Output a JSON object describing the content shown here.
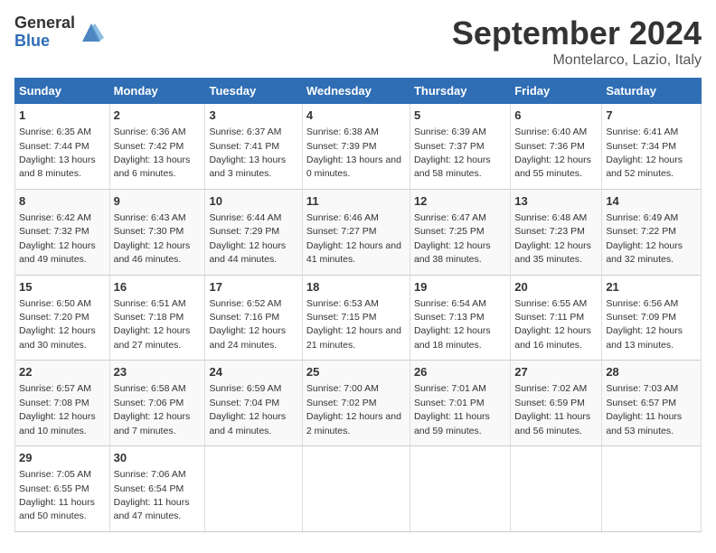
{
  "header": {
    "logo_general": "General",
    "logo_blue": "Blue",
    "month_title": "September 2024",
    "location": "Montelarco, Lazio, Italy"
  },
  "days_of_week": [
    "Sunday",
    "Monday",
    "Tuesday",
    "Wednesday",
    "Thursday",
    "Friday",
    "Saturday"
  ],
  "weeks": [
    [
      {
        "day": "1",
        "sunrise": "6:35 AM",
        "sunset": "7:44 PM",
        "daylight": "13 hours and 8 minutes."
      },
      {
        "day": "2",
        "sunrise": "6:36 AM",
        "sunset": "7:42 PM",
        "daylight": "13 hours and 6 minutes."
      },
      {
        "day": "3",
        "sunrise": "6:37 AM",
        "sunset": "7:41 PM",
        "daylight": "13 hours and 3 minutes."
      },
      {
        "day": "4",
        "sunrise": "6:38 AM",
        "sunset": "7:39 PM",
        "daylight": "13 hours and 0 minutes."
      },
      {
        "day": "5",
        "sunrise": "6:39 AM",
        "sunset": "7:37 PM",
        "daylight": "12 hours and 58 minutes."
      },
      {
        "day": "6",
        "sunrise": "6:40 AM",
        "sunset": "7:36 PM",
        "daylight": "12 hours and 55 minutes."
      },
      {
        "day": "7",
        "sunrise": "6:41 AM",
        "sunset": "7:34 PM",
        "daylight": "12 hours and 52 minutes."
      }
    ],
    [
      {
        "day": "8",
        "sunrise": "6:42 AM",
        "sunset": "7:32 PM",
        "daylight": "12 hours and 49 minutes."
      },
      {
        "day": "9",
        "sunrise": "6:43 AM",
        "sunset": "7:30 PM",
        "daylight": "12 hours and 46 minutes."
      },
      {
        "day": "10",
        "sunrise": "6:44 AM",
        "sunset": "7:29 PM",
        "daylight": "12 hours and 44 minutes."
      },
      {
        "day": "11",
        "sunrise": "6:46 AM",
        "sunset": "7:27 PM",
        "daylight": "12 hours and 41 minutes."
      },
      {
        "day": "12",
        "sunrise": "6:47 AM",
        "sunset": "7:25 PM",
        "daylight": "12 hours and 38 minutes."
      },
      {
        "day": "13",
        "sunrise": "6:48 AM",
        "sunset": "7:23 PM",
        "daylight": "12 hours and 35 minutes."
      },
      {
        "day": "14",
        "sunrise": "6:49 AM",
        "sunset": "7:22 PM",
        "daylight": "12 hours and 32 minutes."
      }
    ],
    [
      {
        "day": "15",
        "sunrise": "6:50 AM",
        "sunset": "7:20 PM",
        "daylight": "12 hours and 30 minutes."
      },
      {
        "day": "16",
        "sunrise": "6:51 AM",
        "sunset": "7:18 PM",
        "daylight": "12 hours and 27 minutes."
      },
      {
        "day": "17",
        "sunrise": "6:52 AM",
        "sunset": "7:16 PM",
        "daylight": "12 hours and 24 minutes."
      },
      {
        "day": "18",
        "sunrise": "6:53 AM",
        "sunset": "7:15 PM",
        "daylight": "12 hours and 21 minutes."
      },
      {
        "day": "19",
        "sunrise": "6:54 AM",
        "sunset": "7:13 PM",
        "daylight": "12 hours and 18 minutes."
      },
      {
        "day": "20",
        "sunrise": "6:55 AM",
        "sunset": "7:11 PM",
        "daylight": "12 hours and 16 minutes."
      },
      {
        "day": "21",
        "sunrise": "6:56 AM",
        "sunset": "7:09 PM",
        "daylight": "12 hours and 13 minutes."
      }
    ],
    [
      {
        "day": "22",
        "sunrise": "6:57 AM",
        "sunset": "7:08 PM",
        "daylight": "12 hours and 10 minutes."
      },
      {
        "day": "23",
        "sunrise": "6:58 AM",
        "sunset": "7:06 PM",
        "daylight": "12 hours and 7 minutes."
      },
      {
        "day": "24",
        "sunrise": "6:59 AM",
        "sunset": "7:04 PM",
        "daylight": "12 hours and 4 minutes."
      },
      {
        "day": "25",
        "sunrise": "7:00 AM",
        "sunset": "7:02 PM",
        "daylight": "12 hours and 2 minutes."
      },
      {
        "day": "26",
        "sunrise": "7:01 AM",
        "sunset": "7:01 PM",
        "daylight": "11 hours and 59 minutes."
      },
      {
        "day": "27",
        "sunrise": "7:02 AM",
        "sunset": "6:59 PM",
        "daylight": "11 hours and 56 minutes."
      },
      {
        "day": "28",
        "sunrise": "7:03 AM",
        "sunset": "6:57 PM",
        "daylight": "11 hours and 53 minutes."
      }
    ],
    [
      {
        "day": "29",
        "sunrise": "7:05 AM",
        "sunset": "6:55 PM",
        "daylight": "11 hours and 50 minutes."
      },
      {
        "day": "30",
        "sunrise": "7:06 AM",
        "sunset": "6:54 PM",
        "daylight": "11 hours and 47 minutes."
      },
      {
        "day": "",
        "sunrise": "",
        "sunset": "",
        "daylight": ""
      },
      {
        "day": "",
        "sunrise": "",
        "sunset": "",
        "daylight": ""
      },
      {
        "day": "",
        "sunrise": "",
        "sunset": "",
        "daylight": ""
      },
      {
        "day": "",
        "sunrise": "",
        "sunset": "",
        "daylight": ""
      },
      {
        "day": "",
        "sunrise": "",
        "sunset": "",
        "daylight": ""
      }
    ]
  ]
}
